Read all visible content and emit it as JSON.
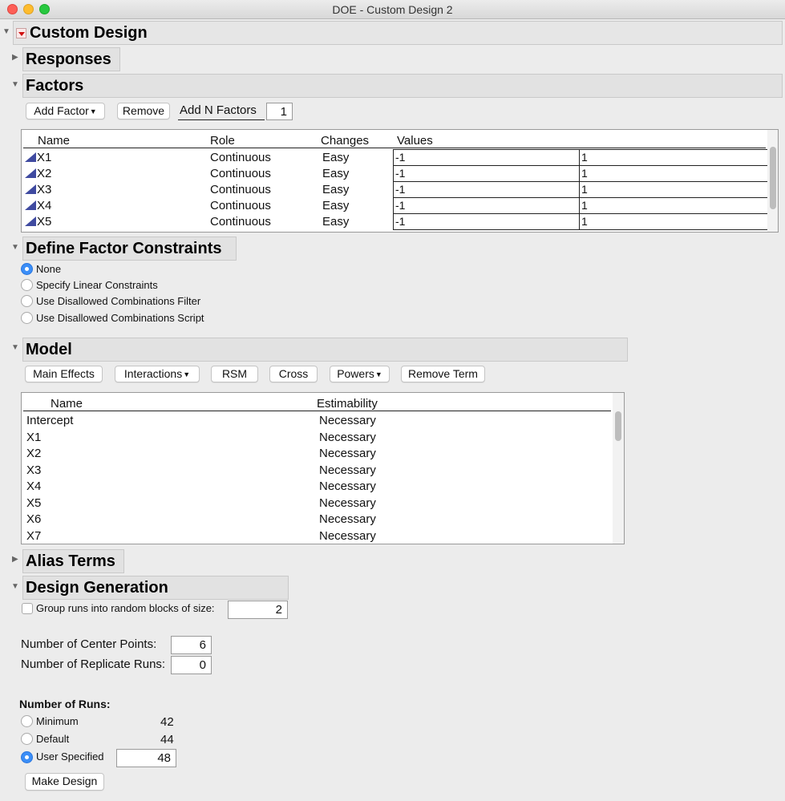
{
  "window": {
    "title": "DOE - Custom Design 2"
  },
  "custom_design": {
    "title": "Custom Design"
  },
  "responses": {
    "title": "Responses"
  },
  "factors": {
    "title": "Factors",
    "add_factor_label": "Add Factor",
    "remove_label": "Remove",
    "add_n_factors_label": "Add N Factors",
    "add_n_factors_value": "1",
    "columns": [
      "Name",
      "Role",
      "Changes",
      "Values"
    ],
    "rows": [
      {
        "name": "X1",
        "role": "Continuous",
        "changes": "Easy",
        "low": "-1",
        "high": "1"
      },
      {
        "name": "X2",
        "role": "Continuous",
        "changes": "Easy",
        "low": "-1",
        "high": "1"
      },
      {
        "name": "X3",
        "role": "Continuous",
        "changes": "Easy",
        "low": "-1",
        "high": "1"
      },
      {
        "name": "X4",
        "role": "Continuous",
        "changes": "Easy",
        "low": "-1",
        "high": "1"
      },
      {
        "name": "X5",
        "role": "Continuous",
        "changes": "Easy",
        "low": "-1",
        "high": "1"
      }
    ]
  },
  "constraints": {
    "title": "Define Factor Constraints",
    "options": [
      {
        "label": "None",
        "selected": true
      },
      {
        "label": "Specify Linear Constraints",
        "selected": false
      },
      {
        "label": "Use Disallowed Combinations Filter",
        "selected": false
      },
      {
        "label": "Use Disallowed Combinations Script",
        "selected": false
      }
    ]
  },
  "model": {
    "title": "Model",
    "buttons": {
      "main_effects": "Main Effects",
      "interactions": "Interactions",
      "rsm": "RSM",
      "cross": "Cross",
      "powers": "Powers",
      "remove_term": "Remove Term"
    },
    "columns": [
      "Name",
      "Estimability"
    ],
    "rows": [
      {
        "name": "Intercept",
        "estimability": "Necessary"
      },
      {
        "name": "X1",
        "estimability": "Necessary"
      },
      {
        "name": "X2",
        "estimability": "Necessary"
      },
      {
        "name": "X3",
        "estimability": "Necessary"
      },
      {
        "name": "X4",
        "estimability": "Necessary"
      },
      {
        "name": "X5",
        "estimability": "Necessary"
      },
      {
        "name": "X6",
        "estimability": "Necessary"
      },
      {
        "name": "X7",
        "estimability": "Necessary"
      }
    ]
  },
  "alias_terms": {
    "title": "Alias Terms"
  },
  "design_generation": {
    "title": "Design Generation",
    "group_runs_label": "Group runs into random blocks of size:",
    "group_runs_value": "2",
    "center_points_label": "Number of Center Points:",
    "center_points_value": "6",
    "replicate_runs_label": "Number of Replicate Runs:",
    "replicate_runs_value": "0",
    "number_of_runs_label": "Number of Runs:",
    "minimum_label": "Minimum",
    "minimum_value": "42",
    "default_label": "Default",
    "default_value": "44",
    "user_specified_label": "User Specified",
    "user_specified_value": "48",
    "make_design_label": "Make Design"
  }
}
